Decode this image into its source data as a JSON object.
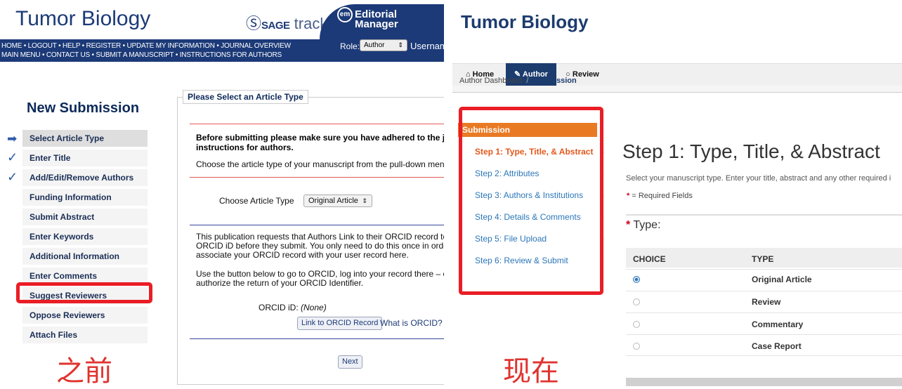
{
  "before": {
    "journal_title": "Tumor Biology",
    "sage_brand": "SAGE",
    "sage_track": "track",
    "em_logo_text": "em",
    "em_brand": [
      "Editorial",
      "Manager"
    ],
    "nav_line1": "HOME • LOGOUT • HELP • REGISTER • UPDATE MY INFORMATION • JOURNAL OVERVIEW",
    "nav_line2": "MAIN MENU • CONTACT US • SUBMIT A MANUSCRIPT • INSTRUCTIONS FOR AUTHORS",
    "role_label": "Role:",
    "role_value": "Author",
    "username_label": "Username",
    "sidebar_heading": "New Submission",
    "steps": [
      {
        "label": "Select Article Type",
        "mark": "➡"
      },
      {
        "label": "Enter Title",
        "mark": "✓"
      },
      {
        "label": "Add/Edit/Remove Authors",
        "mark": "✓"
      },
      {
        "label": "Funding Information",
        "mark": ""
      },
      {
        "label": "Submit Abstract",
        "mark": ""
      },
      {
        "label": "Enter Keywords",
        "mark": ""
      },
      {
        "label": "Additional Information",
        "mark": ""
      },
      {
        "label": "Enter Comments",
        "mark": ""
      },
      {
        "label": "Suggest Reviewers",
        "mark": ""
      },
      {
        "label": "Oppose Reviewers",
        "mark": ""
      },
      {
        "label": "Attach Files",
        "mark": ""
      }
    ],
    "panel_legend": "Please Select an Article Type",
    "notice_bold_1": "Before submitting please make sure you have adhered to the jo",
    "notice_bold_2": "instructions for authors.",
    "choose_instruction": "Choose the article type of your manuscript from the pull-down menu.",
    "choose_label": "Choose Article Type",
    "choose_value": "Original Article",
    "orcid_text": [
      "This publication requests that Authors Link to their ORCID record to Au",
      "ORCID iD before they submit. You only need to do this once in order to",
      "associate your ORCID record with your user record here."
    ],
    "orcid_text2": [
      "Use the button below to go to ORCID, log into your record there – or c",
      "authorize the return of your ORCID Identifier."
    ],
    "orcid_label": "ORCID iD:",
    "orcid_value": "(None)",
    "link_orcid_button": "Link to ORCID Record",
    "what_is_orcid": "What is ORCID?",
    "next_button": "Next",
    "caption": "之前"
  },
  "after": {
    "journal_title": "Tumor Biology",
    "tabs": [
      {
        "icon": "home-icon",
        "glyph": "⌂",
        "label": "Home"
      },
      {
        "icon": "pencil-icon",
        "glyph": "✎",
        "label": "Author"
      },
      {
        "icon": "comment-icon",
        "glyph": "○",
        "label": "Review"
      }
    ],
    "breadcrumb": {
      "root": "Author Dashboard",
      "sep": "/",
      "current": "Submission"
    },
    "sidebar_heading": "Submission",
    "sidebar_items": [
      "Step 1: Type, Title, & Abstract",
      "Step 2: Attributes",
      "Step 3: Authors & Institutions",
      "Step 4: Details & Comments",
      "Step 5: File Upload",
      "Step 6: Review & Submit"
    ],
    "step_title": "Step 1: Type, Title, & Abstract",
    "step_desc": "Select your manuscript type. Enter your title, abstract and any other required i",
    "required_star": "*",
    "required_text": "= Required Fields",
    "type_label": "Type:",
    "table_headers": [
      "CHOICE",
      "TYPE"
    ],
    "types": [
      {
        "name": "Original Article",
        "checked": true
      },
      {
        "name": "Review",
        "checked": false
      },
      {
        "name": "Commentary",
        "checked": false
      },
      {
        "name": "Case Report",
        "checked": false
      }
    ],
    "caption": "现在"
  },
  "colors": {
    "brand_navy": "#1c3a78",
    "highlight_red": "#ea1d25",
    "accent_orange": "#e97a24",
    "link_blue": "#2b76b8"
  }
}
